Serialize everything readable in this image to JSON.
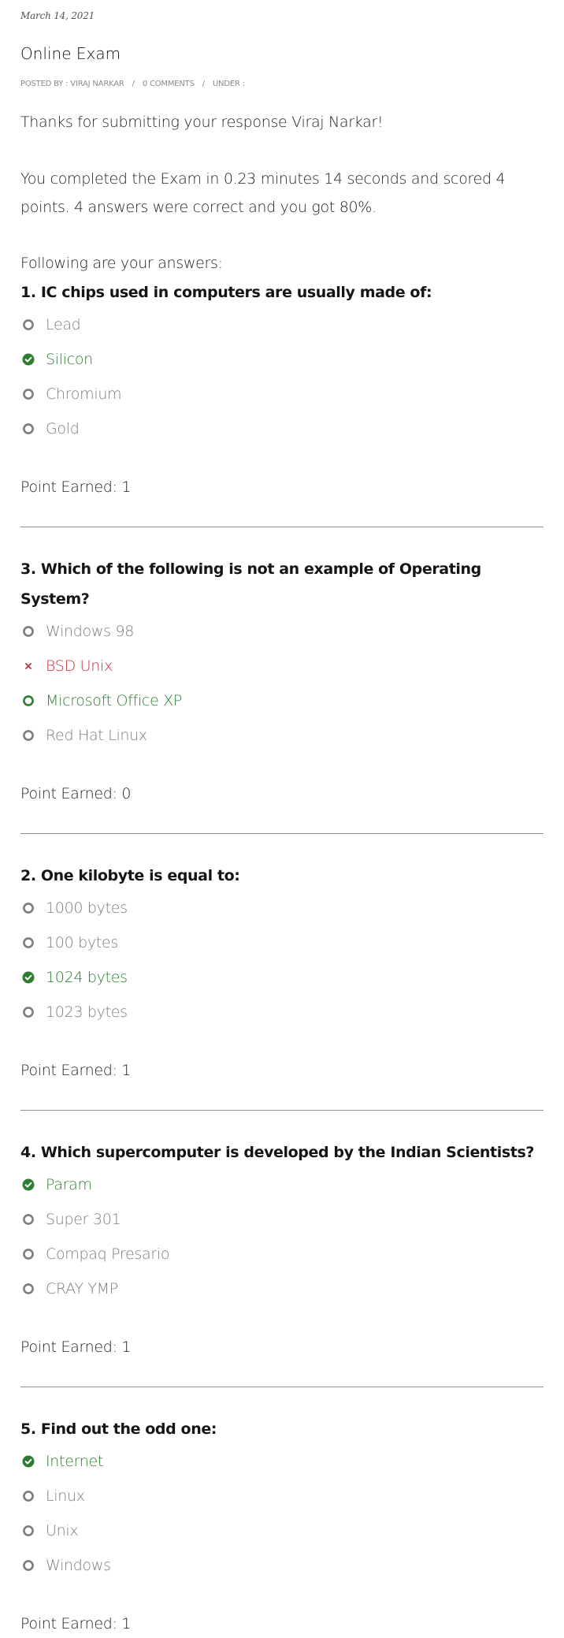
{
  "post": {
    "date": "March 14, 2021",
    "title": "Online Exam",
    "meta": {
      "posted_by": "POSTED BY : VIRAJ NARKAR",
      "separator": "/",
      "comments": "0 COMMENTS",
      "under": "UNDER :"
    }
  },
  "result": {
    "thanks": "Thanks for submitting your response Viraj Narkar!",
    "summary": "You completed the Exam in 0.23 minutes 14 seconds and scored 4 points. 4 answers were correct and you got 80%.",
    "following": "Following are your answers:"
  },
  "colors": {
    "correct": "#2e7d32",
    "wrong": "#c0313e",
    "neutral": "#7d7d7d",
    "divider": "#8c8c8c"
  },
  "questions": [
    {
      "title": "1. IC chips used in computers are usually made of:",
      "options": [
        {
          "label": "Lead",
          "state": "neutral",
          "icon": "circle-outline-icon"
        },
        {
          "label": "Silicon",
          "state": "correct-selected",
          "icon": "check-circle-icon"
        },
        {
          "label": "Chromium",
          "state": "neutral",
          "icon": "circle-outline-icon"
        },
        {
          "label": "Gold",
          "state": "neutral",
          "icon": "circle-outline-icon"
        }
      ],
      "points": "Point Earned: 1"
    },
    {
      "title": "3. Which of the following is not an example of Operating System?",
      "options": [
        {
          "label": "Windows 98",
          "state": "neutral",
          "icon": "circle-outline-icon"
        },
        {
          "label": "BSD Unix",
          "state": "wrong-selected",
          "icon": "cross-icon"
        },
        {
          "label": "Microsoft Office XP",
          "state": "correct-unselected",
          "icon": "circle-outline-icon"
        },
        {
          "label": "Red Hat Linux",
          "state": "neutral",
          "icon": "circle-outline-icon"
        }
      ],
      "points": "Point Earned: 0"
    },
    {
      "title": "2. One kilobyte is equal to:",
      "options": [
        {
          "label": "1000 bytes",
          "state": "neutral",
          "icon": "circle-outline-icon"
        },
        {
          "label": "100 bytes",
          "state": "neutral",
          "icon": "circle-outline-icon"
        },
        {
          "label": "1024 bytes",
          "state": "correct-selected",
          "icon": "check-circle-icon"
        },
        {
          "label": "1023 bytes",
          "state": "neutral",
          "icon": "circle-outline-icon"
        }
      ],
      "points": "Point Earned: 1"
    },
    {
      "title": "4. Which supercomputer is developed by the Indian Scientists?",
      "options": [
        {
          "label": "Param",
          "state": "correct-selected",
          "icon": "check-circle-icon"
        },
        {
          "label": "Super 301",
          "state": "neutral",
          "icon": "circle-outline-icon"
        },
        {
          "label": "Compaq Presario",
          "state": "neutral",
          "icon": "circle-outline-icon"
        },
        {
          "label": "CRAY YMP",
          "state": "neutral",
          "icon": "circle-outline-icon"
        }
      ],
      "points": "Point Earned: 1"
    },
    {
      "title": "5. Find out the odd one:",
      "options": [
        {
          "label": "Internet",
          "state": "correct-selected",
          "icon": "check-circle-icon"
        },
        {
          "label": "Linux",
          "state": "neutral",
          "icon": "circle-outline-icon"
        },
        {
          "label": "Unix",
          "state": "neutral",
          "icon": "circle-outline-icon"
        },
        {
          "label": "Windows",
          "state": "neutral",
          "icon": "circle-outline-icon"
        }
      ],
      "points": "Point Earned: 1"
    }
  ]
}
